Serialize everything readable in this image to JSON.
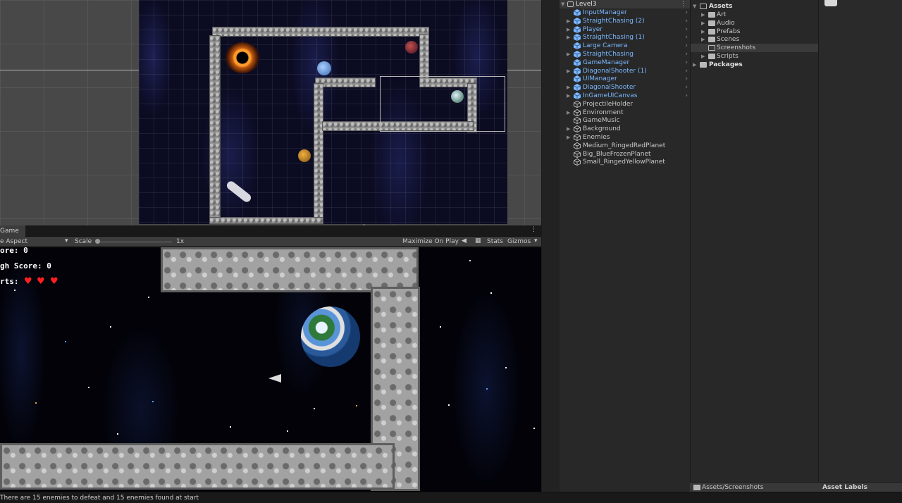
{
  "game_panel": {
    "tab_label": "Game",
    "aspect_label": "e Aspect",
    "scale_label": "Scale",
    "scale_value": "1x",
    "maximize_label": "Maximize On Play",
    "stats_label": "Stats",
    "gizmos_label": "Gizmos"
  },
  "hud": {
    "score": "ore: 0",
    "high_score": "gh Score: 0",
    "hearts_label": "rts:"
  },
  "hierarchy": {
    "scene_name": "Level3",
    "items": [
      {
        "label": "InputManager",
        "prefab": true,
        "expandable": false
      },
      {
        "label": "StraightChasing (2)",
        "prefab": true,
        "expandable": true
      },
      {
        "label": "Player",
        "prefab": true,
        "expandable": true
      },
      {
        "label": "StraightChasing (1)",
        "prefab": true,
        "expandable": true
      },
      {
        "label": "Large Camera",
        "prefab": true,
        "expandable": false
      },
      {
        "label": "StraightChasing",
        "prefab": true,
        "expandable": true
      },
      {
        "label": "GameManager",
        "prefab": true,
        "expandable": false
      },
      {
        "label": "DiagonalShooter (1)",
        "prefab": true,
        "expandable": true
      },
      {
        "label": "UIManager",
        "prefab": true,
        "expandable": false
      },
      {
        "label": "DiagonalShooter",
        "prefab": true,
        "expandable": true
      },
      {
        "label": "InGameUICanvas",
        "prefab": true,
        "expandable": true
      },
      {
        "label": "ProjectileHolder",
        "prefab": false,
        "expandable": false
      },
      {
        "label": "Environment",
        "prefab": false,
        "expandable": true
      },
      {
        "label": "GameMusic",
        "prefab": false,
        "expandable": false
      },
      {
        "label": "Background",
        "prefab": false,
        "expandable": true
      },
      {
        "label": "Enemies",
        "prefab": false,
        "expandable": true
      },
      {
        "label": "Medium_RingedRedPlanet",
        "prefab": false,
        "expandable": false
      },
      {
        "label": "Big_BlueFrozenPlanet",
        "prefab": false,
        "expandable": false
      },
      {
        "label": "Small_RingedYellowPlanet",
        "prefab": false,
        "expandable": false
      }
    ]
  },
  "project": {
    "assets_label": "Assets",
    "folders": [
      "Art",
      "Audio",
      "Prefabs",
      "Scenes",
      "Screenshots",
      "Scripts"
    ],
    "selected_folder": "Screenshots",
    "packages_label": "Packages",
    "footer_path": "Assets/Screenshots"
  },
  "inspector": {
    "asset_labels": "Asset Labels"
  },
  "status_bar": {
    "message": "There are 15 enemies to defeat and 15 enemies found at start"
  },
  "colors": {
    "prefab_blue": "#7ab8ff",
    "heart_red": "#ff2020",
    "panel_bg": "#282828"
  }
}
